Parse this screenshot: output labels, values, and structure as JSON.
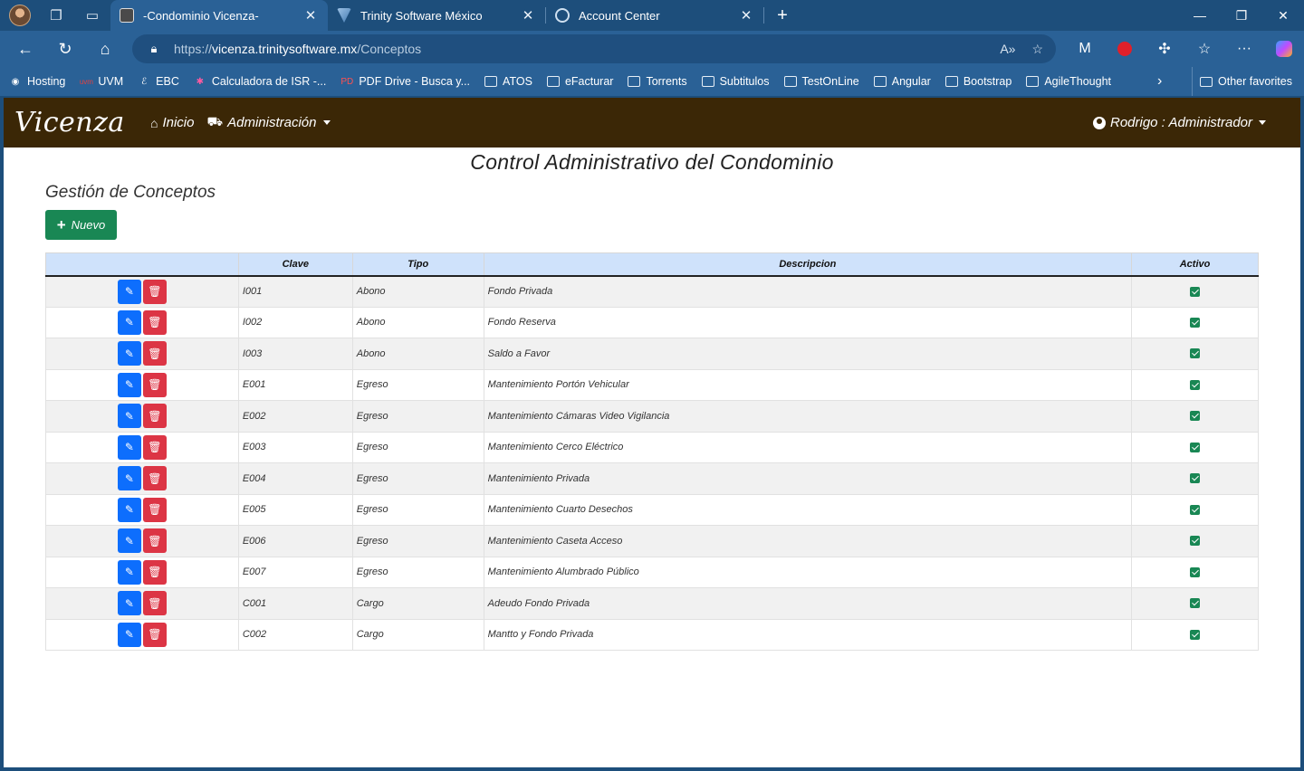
{
  "browser": {
    "tabs": [
      {
        "title": "-Condominio Vicenza-",
        "active": true
      },
      {
        "title": "Trinity Software México",
        "active": false
      },
      {
        "title": "Account Center",
        "active": false
      }
    ],
    "url": {
      "scheme": "https://",
      "host": "vicenza.trinitysoftware.mx",
      "path": "/Conceptos"
    },
    "bookmarks": [
      "Hosting",
      "UVM",
      "EBC",
      "Calculadora de ISR -...",
      "PDF Drive - Busca y...",
      "ATOS",
      "eFacturar",
      "Torrents",
      "Subtitulos",
      "TestOnLine",
      "Angular",
      "Bootstrap",
      "AgileThought"
    ],
    "other_favorites": "Other favorites"
  },
  "site": {
    "brand": "Vicenza",
    "menu": {
      "home": "Inicio",
      "admin": "Administración"
    },
    "user": "Rodrigo : Administrador"
  },
  "page": {
    "title": "Control Administrativo del Condominio",
    "section": "Gestión de Conceptos",
    "new_button": "Nuevo"
  },
  "table": {
    "headers": [
      "",
      "Clave",
      "Tipo",
      "Descripcion",
      "Activo"
    ],
    "rows": [
      {
        "clave": "I001",
        "tipo": "Abono",
        "descripcion": "Fondo Privada",
        "activo": true
      },
      {
        "clave": "I002",
        "tipo": "Abono",
        "descripcion": "Fondo Reserva",
        "activo": true
      },
      {
        "clave": "I003",
        "tipo": "Abono",
        "descripcion": "Saldo a Favor",
        "activo": true
      },
      {
        "clave": "E001",
        "tipo": "Egreso",
        "descripcion": "Mantenimiento Portón Vehicular",
        "activo": true
      },
      {
        "clave": "E002",
        "tipo": "Egreso",
        "descripcion": "Mantenimiento Cámaras Video Vigilancia",
        "activo": true
      },
      {
        "clave": "E003",
        "tipo": "Egreso",
        "descripcion": "Mantenimiento Cerco Eléctrico",
        "activo": true
      },
      {
        "clave": "E004",
        "tipo": "Egreso",
        "descripcion": "Mantenimiento Privada",
        "activo": true
      },
      {
        "clave": "E005",
        "tipo": "Egreso",
        "descripcion": "Mantenimiento Cuarto Desechos",
        "activo": true
      },
      {
        "clave": "E006",
        "tipo": "Egreso",
        "descripcion": "Mantenimiento Caseta Acceso",
        "activo": true
      },
      {
        "clave": "E007",
        "tipo": "Egreso",
        "descripcion": "Mantenimiento Alumbrado Público",
        "activo": true
      },
      {
        "clave": "C001",
        "tipo": "Cargo",
        "descripcion": "Adeudo Fondo Privada",
        "activo": true
      },
      {
        "clave": "C002",
        "tipo": "Cargo",
        "descripcion": "Mantto y Fondo Privada",
        "activo": true
      }
    ]
  },
  "colors": {
    "navbar": "#3b2706",
    "primary": "#0d6efd",
    "danger": "#dc3545",
    "success": "#198754",
    "table_header": "#cfe2fb",
    "browser_chrome": "#2a6196"
  }
}
